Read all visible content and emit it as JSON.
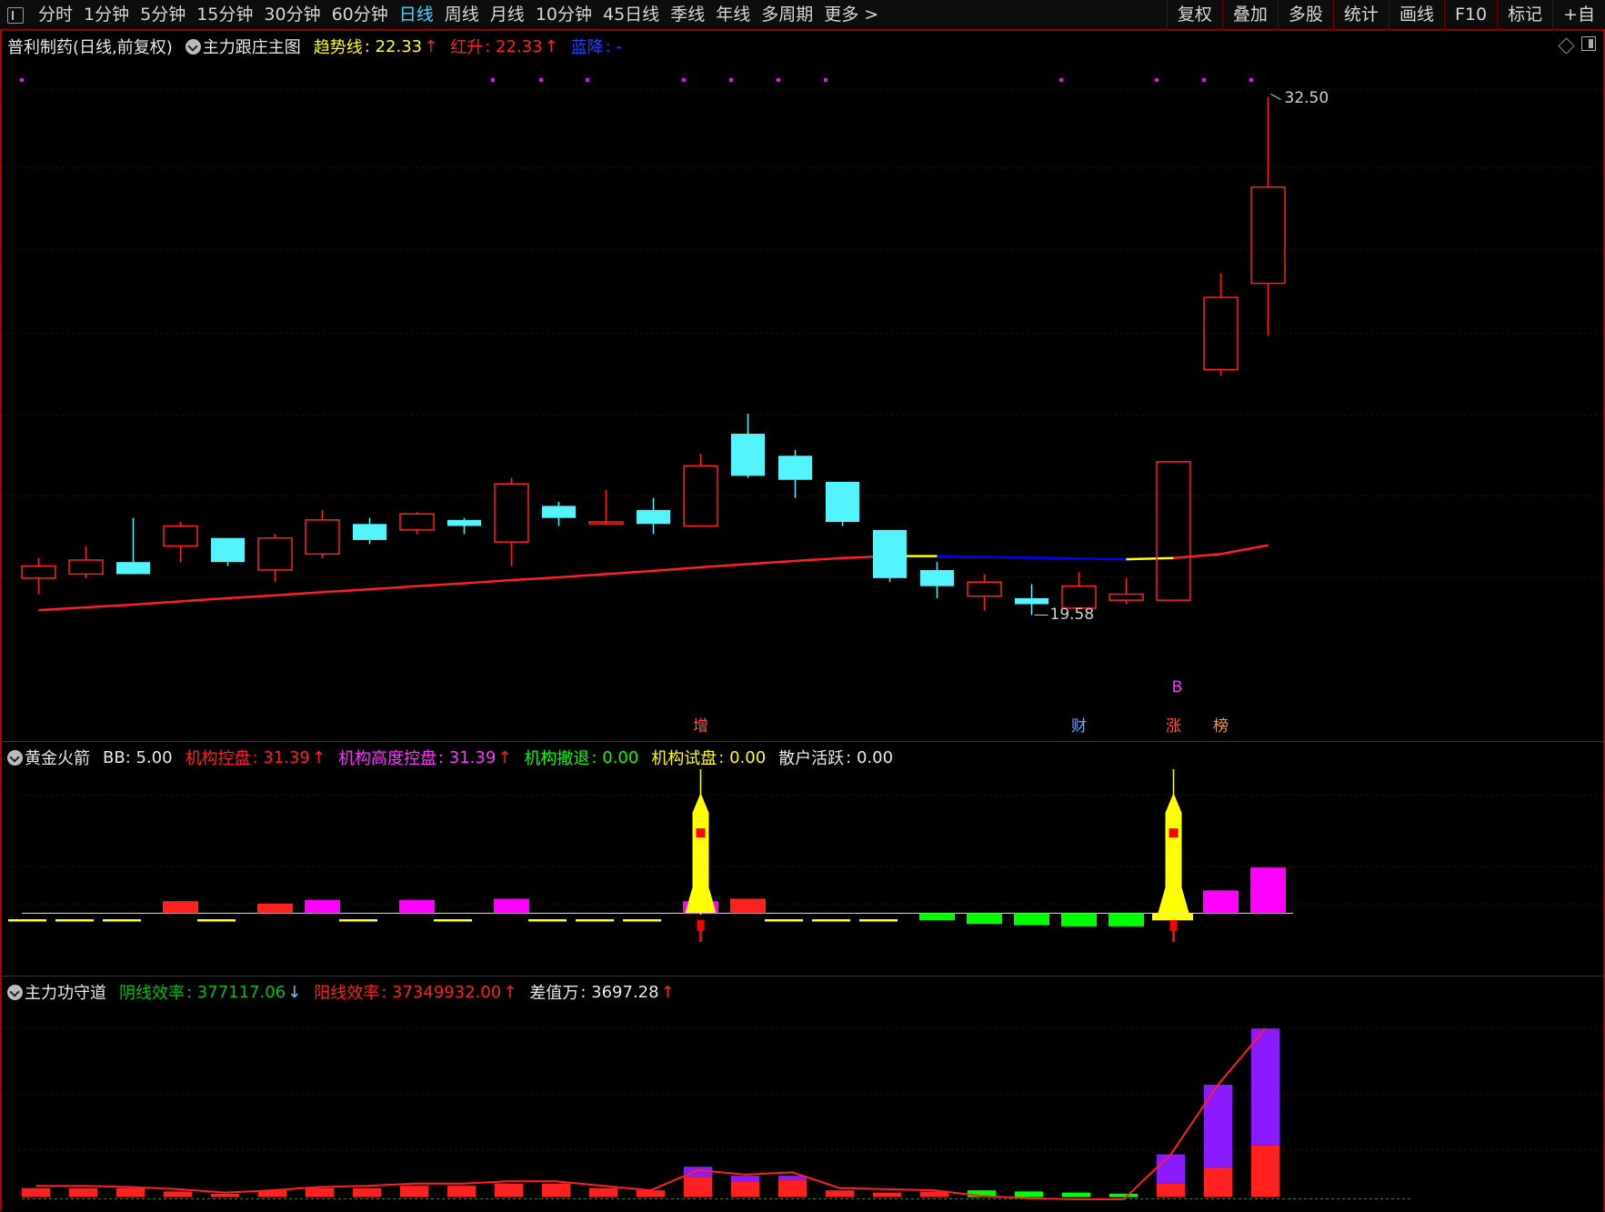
{
  "toolbar": {
    "periods": [
      "分时",
      "1分钟",
      "5分钟",
      "15分钟",
      "30分钟",
      "60分钟",
      "日线",
      "周线",
      "月线",
      "10分钟",
      "45日线",
      "季线",
      "年线",
      "多周期",
      "更多 >"
    ],
    "active_period": "日线",
    "tools": [
      "复权",
      "叠加",
      "多股",
      "统计",
      "画线",
      "F10",
      "标记",
      "+自"
    ]
  },
  "main_panel": {
    "legend": {
      "stock": "普利制药(日线,前复权)",
      "indicator": "主力跟庄主图",
      "trend_label": "趋势线",
      "trend_value": ": 22.33",
      "red_label": "红升",
      "red_value": ": 22.33",
      "blue_label": "蓝降",
      "blue_value": ": -"
    },
    "high_label": "32.50",
    "low_label": "19.58",
    "b_marker": "B",
    "event_markers": [
      "增",
      "财",
      "涨",
      "榜"
    ]
  },
  "indicator1": {
    "legend": {
      "name": "黄金火箭",
      "bb": "BB: 5.00",
      "jgkp_label": "机构控盘",
      "jgkp_value": ": 31.39",
      "jggdkp_label": "机构高度控盘",
      "jggdkp_value": ": 31.39",
      "jgct_label": "机构撤退",
      "jgct_value": ": 0.00",
      "jgsp_label": "机构试盘",
      "jgsp_value": ": 0.00",
      "shhy_label": "散户活跃",
      "shhy_value": ": 0.00"
    }
  },
  "indicator2": {
    "legend": {
      "name": "主力功守道",
      "yin_label": "阴线效率",
      "yin_value": ": 377117.06",
      "yang_label": "阳线效率",
      "yang_value": ": 37349932.00",
      "diff_label": "差值万",
      "diff_value": ": 3697.28"
    }
  },
  "colors": {
    "up": "#ff2020",
    "down": "#54f4ff",
    "trend": "#ff2020",
    "trend_flat": "#ffff00",
    "trend_down": "#0000ff",
    "magenta": "#ff00ff",
    "green": "#00ff00",
    "yellow": "#ffff00",
    "purple": "#8b1aff",
    "grid": "#5a0000"
  },
  "chart_data": [
    {
      "type": "candlestick",
      "title": "普利制药(日线,前复权)",
      "candles": [
        {
          "o": 20.5,
          "h": 21.0,
          "l": 20.1,
          "c": 20.8
        },
        {
          "o": 20.6,
          "h": 21.3,
          "l": 20.5,
          "c": 20.95
        },
        {
          "o": 20.9,
          "h": 22.0,
          "l": 20.6,
          "c": 20.6
        },
        {
          "o": 21.3,
          "h": 21.9,
          "l": 20.9,
          "c": 21.8
        },
        {
          "o": 21.5,
          "h": 21.5,
          "l": 20.8,
          "c": 20.9
        },
        {
          "o": 20.7,
          "h": 21.6,
          "l": 20.4,
          "c": 21.5
        },
        {
          "o": 21.1,
          "h": 22.2,
          "l": 21.0,
          "c": 21.95
        },
        {
          "o": 21.85,
          "h": 22.0,
          "l": 21.35,
          "c": 21.45
        },
        {
          "o": 21.7,
          "h": 22.15,
          "l": 21.6,
          "c": 22.1
        },
        {
          "o": 21.95,
          "h": 22.0,
          "l": 21.6,
          "c": 21.8
        },
        {
          "o": 21.4,
          "h": 23.0,
          "l": 20.8,
          "c": 22.85
        },
        {
          "o": 22.3,
          "h": 22.4,
          "l": 21.8,
          "c": 22.0
        },
        {
          "o": 21.9,
          "h": 22.7,
          "l": 21.85,
          "c": 21.9
        },
        {
          "o": 22.2,
          "h": 22.5,
          "l": 21.6,
          "c": 21.85
        },
        {
          "o": 21.8,
          "h": 23.6,
          "l": 21.8,
          "c": 23.3
        },
        {
          "o": 24.1,
          "h": 24.6,
          "l": 23.0,
          "c": 23.05
        },
        {
          "o": 23.55,
          "h": 23.7,
          "l": 22.5,
          "c": 22.95
        },
        {
          "o": 22.9,
          "h": 22.9,
          "l": 21.8,
          "c": 21.9
        },
        {
          "o": 21.7,
          "h": 21.7,
          "l": 20.4,
          "c": 20.5
        },
        {
          "o": 20.7,
          "h": 20.9,
          "l": 20.0,
          "c": 20.3
        },
        {
          "o": 20.05,
          "h": 20.6,
          "l": 19.7,
          "c": 20.4
        },
        {
          "o": 20.0,
          "h": 20.35,
          "l": 19.58,
          "c": 19.85
        },
        {
          "o": 19.75,
          "h": 20.65,
          "l": 19.75,
          "c": 20.3
        },
        {
          "o": 19.95,
          "h": 20.5,
          "l": 19.85,
          "c": 20.1
        },
        {
          "o": 19.95,
          "h": 23.4,
          "l": 19.95,
          "c": 23.4
        },
        {
          "o": 25.7,
          "h": 28.1,
          "l": 25.55,
          "c": 27.5
        },
        {
          "o": 27.85,
          "h": 32.5,
          "l": 26.55,
          "c": 30.25
        }
      ],
      "trend_line": [
        19.7,
        19.77,
        19.84,
        19.92,
        20.0,
        20.07,
        20.15,
        20.22,
        20.3,
        20.37,
        20.45,
        20.52,
        20.6,
        20.68,
        20.77,
        20.85,
        20.93,
        21.0,
        21.05,
        21.05,
        21.03,
        21.01,
        20.99,
        20.97,
        21.0,
        21.1,
        21.32
      ],
      "trend_state": [
        "up",
        "up",
        "up",
        "up",
        "up",
        "up",
        "up",
        "up",
        "up",
        "up",
        "up",
        "up",
        "up",
        "up",
        "up",
        "up",
        "up",
        "up",
        "flat",
        "down",
        "down",
        "down",
        "down",
        "flat",
        "up",
        "up",
        "up"
      ],
      "ylim": [
        19.0,
        33.1
      ]
    },
    {
      "type": "bar",
      "title": "黄金火箭",
      "bars": [
        {
          "c": "yellow-dash",
          "v": -0.3
        },
        {
          "c": "yellow-dash",
          "v": -0.3
        },
        {
          "c": "yellow-dash",
          "v": -0.3
        },
        {
          "c": "red",
          "v": 0.5
        },
        {
          "c": "yellow-dash",
          "v": -0.3
        },
        {
          "c": "red",
          "v": 0.4
        },
        {
          "c": "magenta",
          "v": 0.55
        },
        {
          "c": "yellow-dash",
          "v": -0.3
        },
        {
          "c": "magenta",
          "v": 0.55
        },
        {
          "c": "yellow-dash",
          "v": -0.3
        },
        {
          "c": "magenta",
          "v": 0.6
        },
        {
          "c": "yellow-dash",
          "v": -0.3
        },
        {
          "c": "yellow-dash",
          "v": -0.3
        },
        {
          "c": "yellow-dash",
          "v": -0.3
        },
        {
          "c": "magenta",
          "v": 0.5
        },
        {
          "c": "red",
          "v": 0.6
        },
        {
          "c": "yellow-dash",
          "v": -0.3
        },
        {
          "c": "yellow-dash",
          "v": -0.3
        },
        {
          "c": "yellow-dash",
          "v": -0.3
        },
        {
          "c": "green",
          "v": -0.3
        },
        {
          "c": "green",
          "v": -0.45
        },
        {
          "c": "green",
          "v": -0.5
        },
        {
          "c": "green",
          "v": -0.55
        },
        {
          "c": "green",
          "v": -0.55
        },
        {
          "c": "yellow",
          "v": -0.3
        },
        {
          "c": "magenta",
          "v": 0.95
        },
        {
          "c": "magenta",
          "v": 1.9
        }
      ],
      "rockets": [
        14,
        24
      ],
      "ylim": [
        -1.2,
        6.0
      ]
    },
    {
      "type": "bar",
      "title": "主力功守道",
      "bars": [
        {
          "r": 0.4
        },
        {
          "r": 0.4
        },
        {
          "r": 0.4
        },
        {
          "r": 0.25
        },
        {
          "r": 0.15
        },
        {
          "r": 0.3
        },
        {
          "r": 0.4
        },
        {
          "r": 0.4
        },
        {
          "r": 0.5
        },
        {
          "r": 0.5
        },
        {
          "r": 0.6
        },
        {
          "r": 0.6
        },
        {
          "r": 0.4
        },
        {
          "r": 0.3
        },
        {
          "r": 0.9,
          "p": 0.45
        },
        {
          "r": 0.7,
          "p": 0.25
        },
        {
          "r": 0.75,
          "p": 0.2
        },
        {
          "r": 0.3
        },
        {
          "r": 0.2
        },
        {
          "r": 0.25
        },
        {
          "g": 0.3
        },
        {
          "g": 0.25
        },
        {
          "g": 0.2
        },
        {
          "g": 0.15
        },
        {
          "r": 0.6,
          "p": 1.3
        },
        {
          "r": 1.3,
          "p": 3.7
        },
        {
          "r": 2.3,
          "p": 5.2
        }
      ],
      "line": [
        0.5,
        0.5,
        0.45,
        0.35,
        0.2,
        0.3,
        0.45,
        0.5,
        0.6,
        0.6,
        0.7,
        0.7,
        0.5,
        0.3,
        1.2,
        1.0,
        1.1,
        0.4,
        0.35,
        0.3,
        0.05,
        -0.05,
        -0.1,
        -0.1,
        1.9,
        5.0,
        7.5
      ],
      "ylim": [
        -0.3,
        8.6
      ]
    }
  ]
}
